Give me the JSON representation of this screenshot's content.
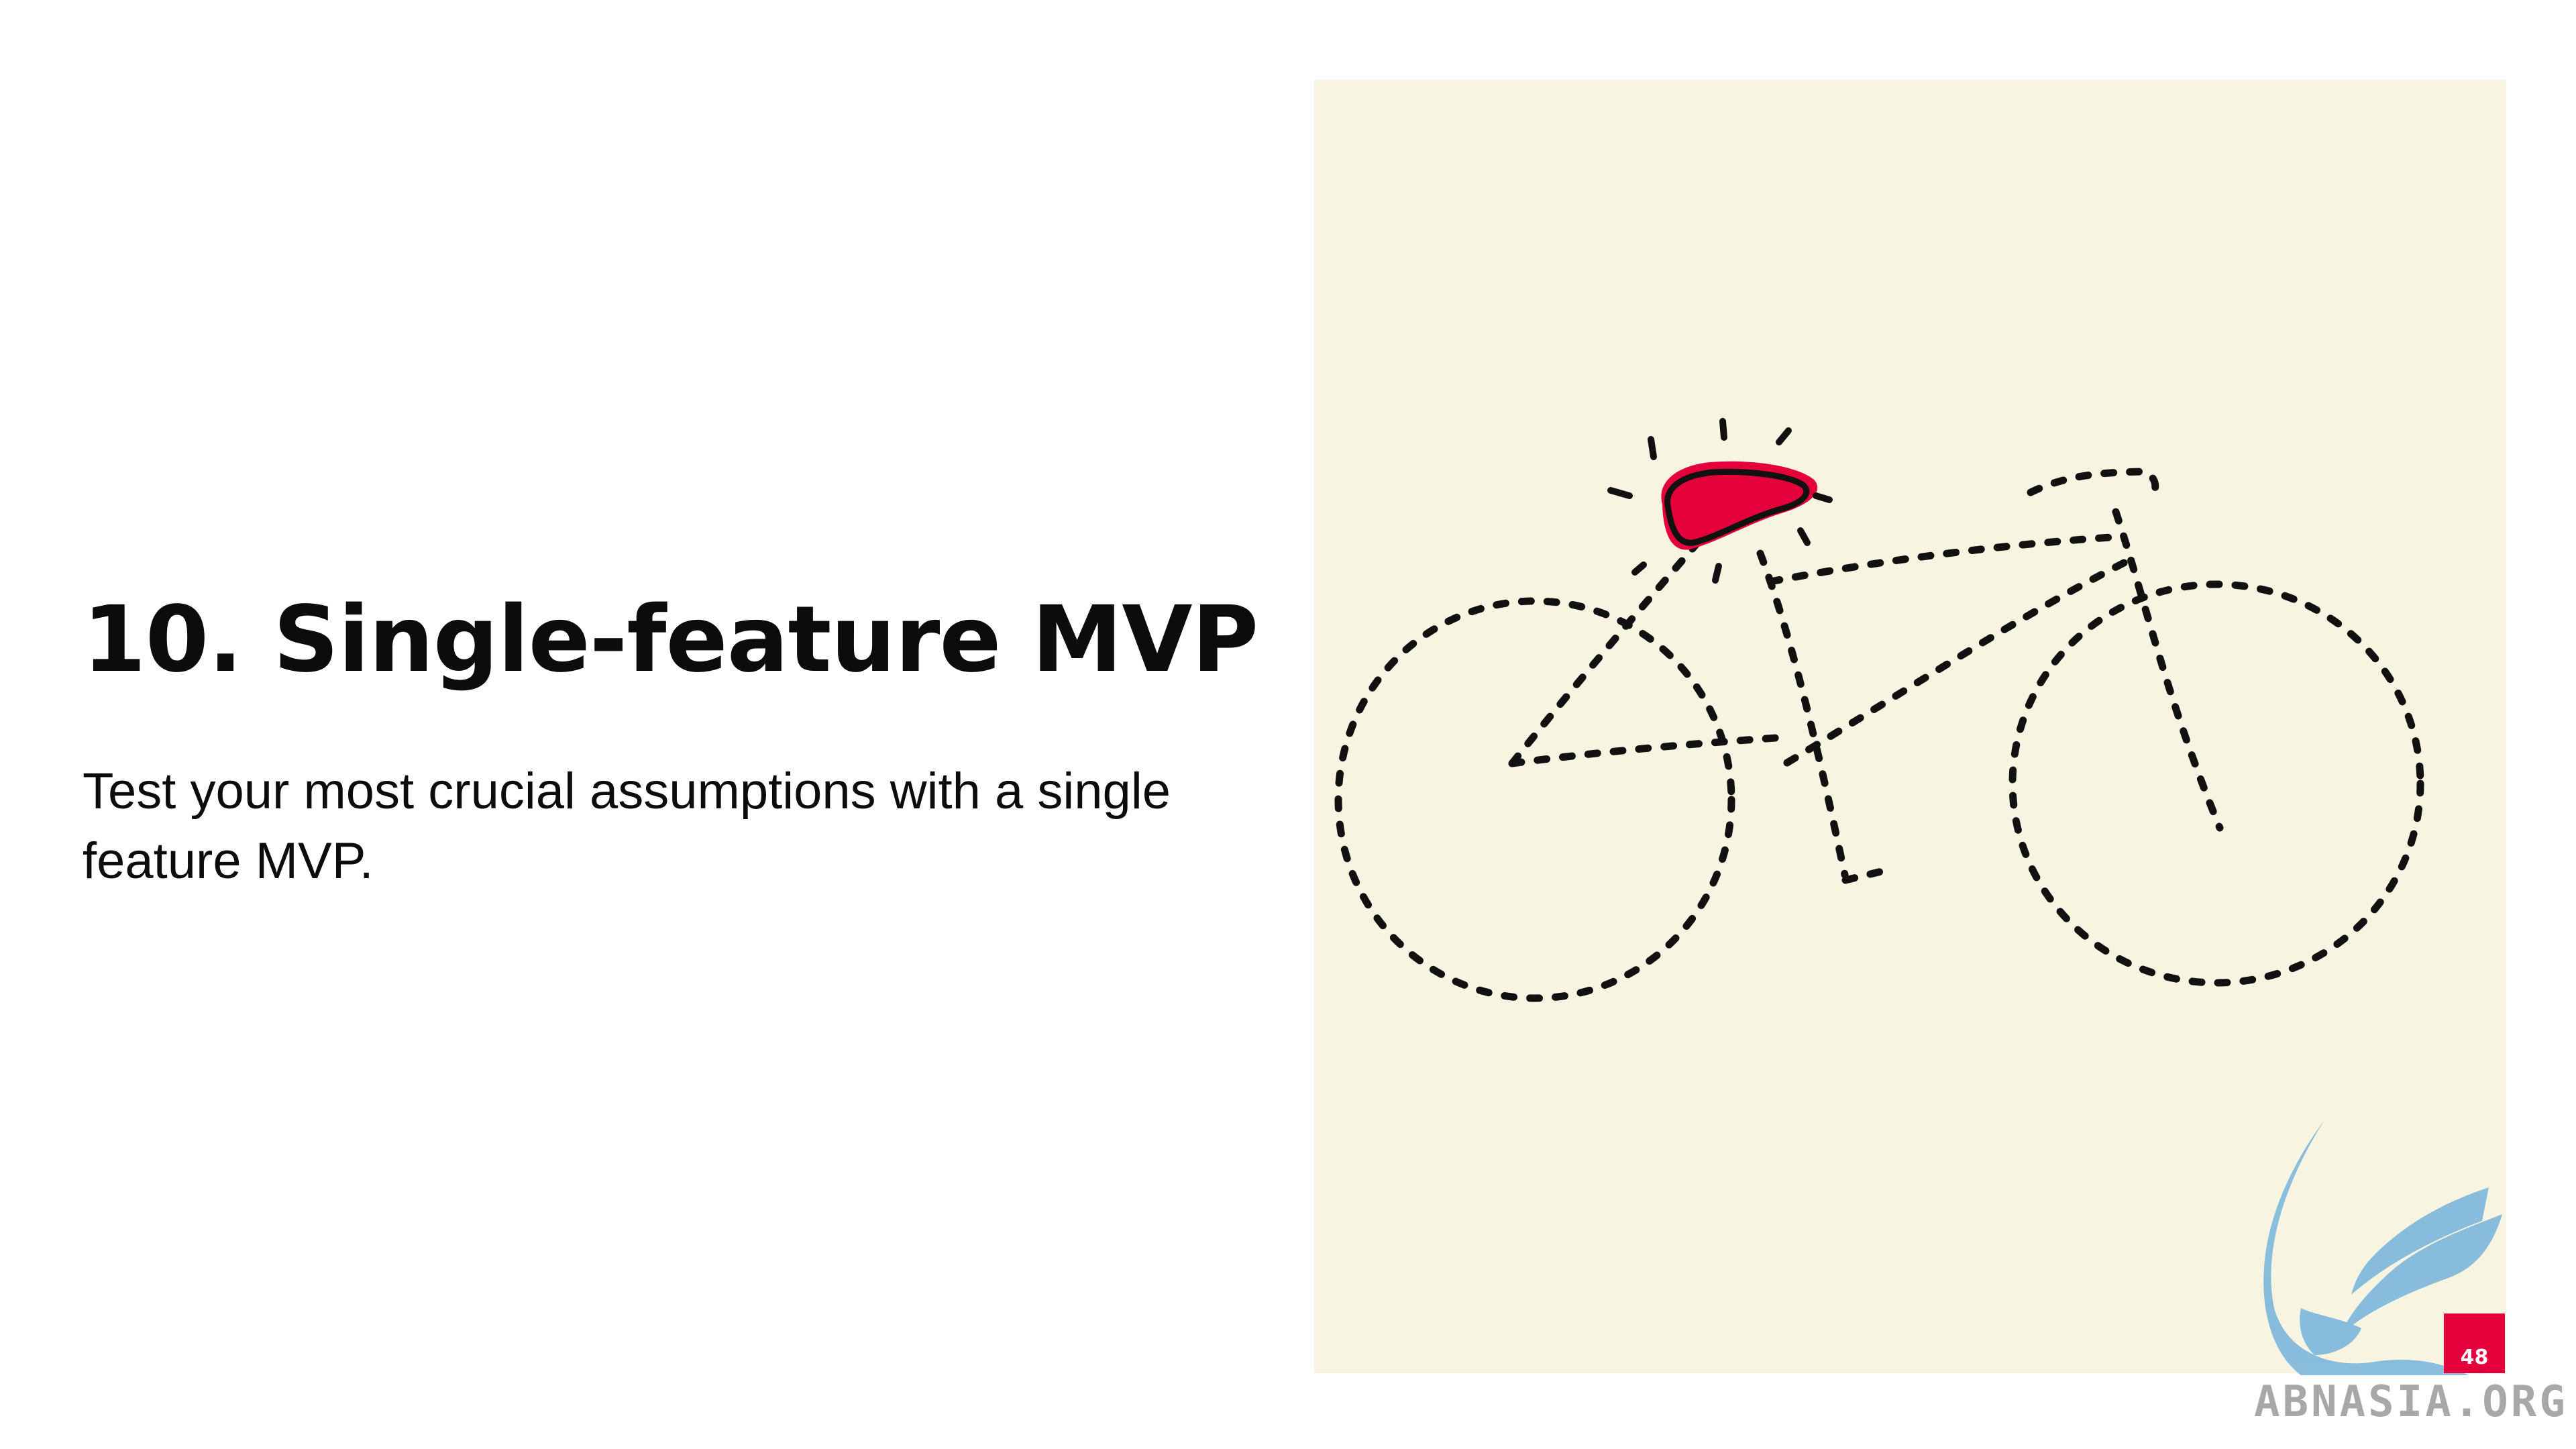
{
  "slide": {
    "title": "10. Single-feature MVP",
    "body": "Test your most crucial assumptions with a single feature MVP.",
    "page_number": "48"
  },
  "illustration": {
    "subject": "bicycle-with-highlighted-saddle",
    "background_color": "#f7f5e2",
    "line_color": "#111111",
    "accent_color": "#e4003a"
  },
  "watermark": {
    "text": "ABNASIA.ORG",
    "color": "#7fb8dc"
  }
}
